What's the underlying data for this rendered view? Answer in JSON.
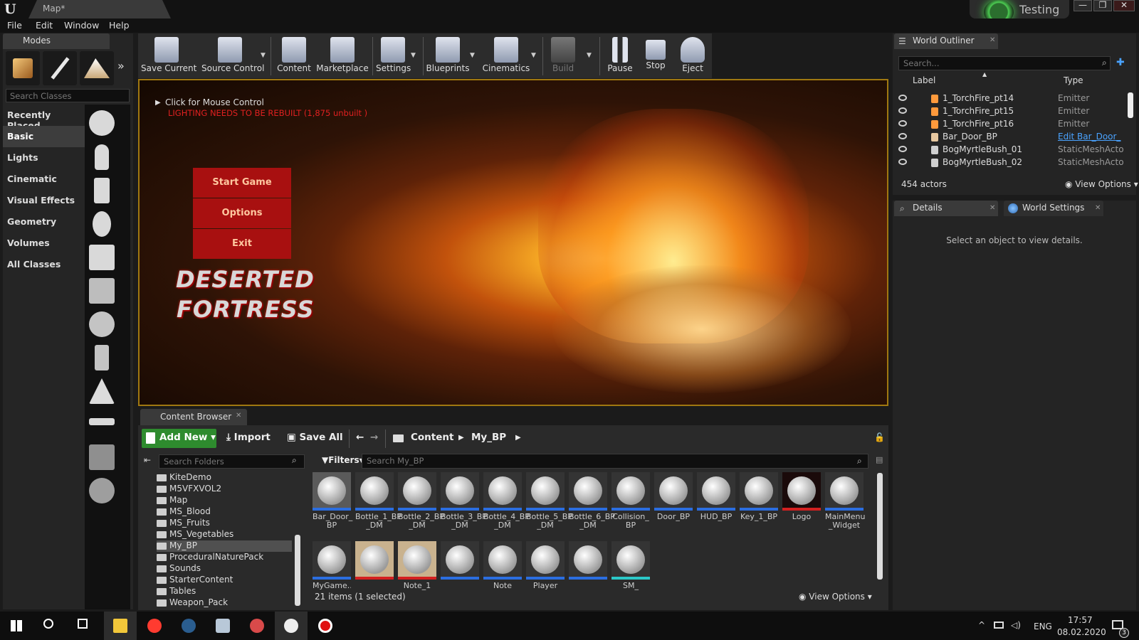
{
  "window": {
    "doc_tab": "Map*",
    "testing_label": "Testing",
    "controls": [
      "—",
      "❐",
      "✕"
    ]
  },
  "menu": [
    "File",
    "Edit",
    "Window",
    "Help"
  ],
  "modes": {
    "tab_label": "Modes",
    "search_placeholder": "Search Classes",
    "categories": [
      "Recently Placed",
      "Basic",
      "Lights",
      "Cinematic",
      "Visual Effects",
      "Geometry",
      "Volumes",
      "All Classes"
    ],
    "active_category": "Basic"
  },
  "toolbar": [
    {
      "label": "Save Current",
      "icon": "save-icon"
    },
    {
      "label": "Source Control",
      "icon": "source-control-icon"
    },
    {
      "label": "Content",
      "icon": "content-icon"
    },
    {
      "label": "Marketplace",
      "icon": "marketplace-icon"
    },
    {
      "label": "Settings",
      "icon": "settings-icon"
    },
    {
      "label": "Blueprints",
      "icon": "blueprints-icon"
    },
    {
      "label": "Cinematics",
      "icon": "cinematics-icon"
    },
    {
      "label": "Build",
      "icon": "build-icon"
    },
    {
      "label": "Pause",
      "icon": "pause-icon"
    },
    {
      "label": "Stop",
      "icon": "stop-icon"
    },
    {
      "label": "Eject",
      "icon": "eject-icon"
    }
  ],
  "viewport": {
    "mouse_hint": "Click for Mouse Control",
    "lighting_warning": "LIGHTING NEEDS TO BE REBUILT (1,875 unbuilt )",
    "game_menu": [
      "Start Game",
      "Options",
      "Exit"
    ],
    "logo_lines": [
      "DESERTED",
      "FORTRESS"
    ]
  },
  "content_browser": {
    "tab_label": "Content Browser",
    "add_new": "Add New",
    "import": "Import",
    "save_all": "Save All",
    "path": [
      "Content",
      "My_BP"
    ],
    "folder_search_placeholder": "Search Folders",
    "asset_search_placeholder": "Search My_BP",
    "filters": "Filters",
    "folders": [
      "KiteDemo",
      "M5VFXVOL2",
      "Map",
      "MS_Blood",
      "MS_Fruits",
      "MS_Vegetables",
      "My_BP",
      "ProceduralNaturePack",
      "Sounds",
      "StarterContent",
      "Tables",
      "Weapon_Pack"
    ],
    "selected_folder": "My_BP",
    "assets_row1": [
      {
        "name": "Bar_Door_\nBP",
        "selected": true
      },
      {
        "name": "Bottle_1_BP\n_DM"
      },
      {
        "name": "Bottle_2_BP\n_DM"
      },
      {
        "name": "Bottle_3_BP\n_DM"
      },
      {
        "name": "Bottle_4_BP\n_DM"
      },
      {
        "name": "Bottle_5_BP\n_DM"
      },
      {
        "name": "Bottle_6_BP\n_DM"
      },
      {
        "name": "Collision_\nBP"
      },
      {
        "name": "Door_BP"
      },
      {
        "name": "HUD_BP"
      },
      {
        "name": "Key_1_BP"
      },
      {
        "name": "Logo"
      },
      {
        "name": "MainMenu\n_Widget"
      }
    ],
    "assets_row2": [
      {
        "name": "MyGame..."
      },
      {
        "name": ""
      },
      {
        "name": "Note_1"
      },
      {
        "name": ""
      },
      {
        "name": "Note"
      },
      {
        "name": "Player"
      },
      {
        "name": ""
      },
      {
        "name": "SM_"
      }
    ],
    "items_count": "21 items (1 selected)",
    "view_options": "View Options"
  },
  "outliner": {
    "tab_label": "World Outliner",
    "search_placeholder": "Search...",
    "col_label": "Label",
    "col_type": "Type",
    "rows": [
      {
        "name": "1_TorchFire_pt14",
        "type": "Emitter"
      },
      {
        "name": "1_TorchFire_pt15",
        "type": "Emitter"
      },
      {
        "name": "1_TorchFire_pt16",
        "type": "Emitter"
      },
      {
        "name": "Bar_Door_BP",
        "type": "Edit Bar_Door_"
      },
      {
        "name": "BogMyrtleBush_01",
        "type": "StaticMeshActo"
      },
      {
        "name": "BogMyrtleBush_02",
        "type": "StaticMeshActo"
      }
    ],
    "actor_count": "454 actors",
    "view_options": "View Options"
  },
  "details": {
    "tab_details": "Details",
    "tab_world_settings": "World Settings",
    "empty_message": "Select an object to view details."
  },
  "taskbar": {
    "apps": [
      "start",
      "search",
      "task-view",
      "explorer",
      "yandex",
      "steam",
      "app",
      "paint",
      "unreal",
      "record"
    ],
    "lang": "ENG",
    "time": "17:57",
    "date": "08.02.2020",
    "notifications": "3"
  }
}
